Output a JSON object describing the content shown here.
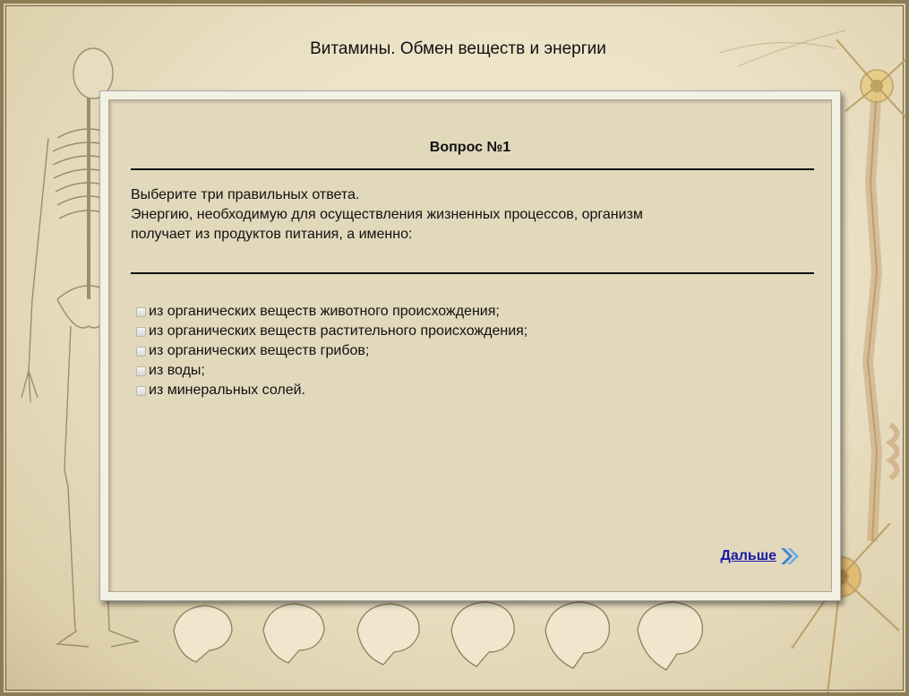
{
  "page": {
    "title": "Витамины. Обмен веществ и энергии"
  },
  "question": {
    "title": "Вопрос №1",
    "text_lines": [
      "Выберите три правильных ответа.",
      "Энергию, необходимую для осуществления жизненных процессов, организм",
      "получает из продуктов питания, а именно:"
    ],
    "answers": [
      "из органических веществ животного происхождения;",
      "из органических веществ растительного происхождения;",
      "из органических веществ грибов;",
      "из воды;",
      "из минеральных солей."
    ]
  },
  "navigation": {
    "next_label": "Дальше",
    "next_icon": "double-chevron-right-icon"
  },
  "colors": {
    "background": "#ece2c6",
    "panel": "#e2d8bc",
    "link": "#1a1aa8"
  }
}
